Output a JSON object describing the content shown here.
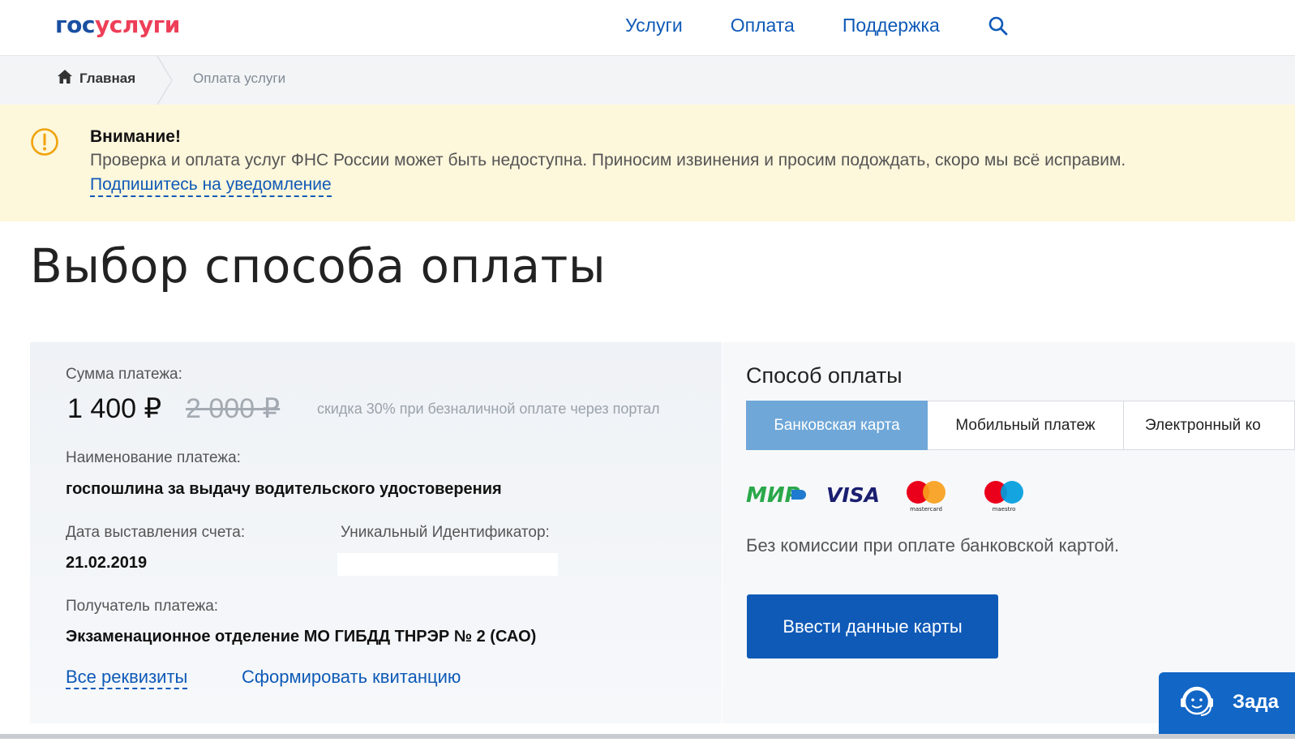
{
  "header": {
    "logo_part1": "гос",
    "logo_part2": "услуги",
    "nav": [
      "Услуги",
      "Оплата",
      "Поддержка"
    ]
  },
  "breadcrumb": {
    "home": "Главная",
    "current": "Оплата услуги"
  },
  "alert": {
    "title": "Внимание!",
    "text": "Проверка и оплата услуг ФНС России может быть недоступна. Приносим извинения и просим подождать, скоро мы всё исправим.",
    "link": "Подпишитесь на уведомление"
  },
  "page_title": "Выбор способа оплаты",
  "payment": {
    "amount_label": "Сумма платежа:",
    "amount": "1 400 ₽",
    "amount_old": "2 000 ₽",
    "discount_note": "скидка 30% при безналичной оплате через портал",
    "name_label": "Наименование платежа:",
    "name": "госпошлина за выдачу водительского удостоверения",
    "date_label": "Дата выставления счета:",
    "date": "21.02.2019",
    "uid_label": "Уникальный Идентификатор:",
    "recipient_label": "Получатель платежа:",
    "recipient": "Экзаменационное отделение МО ГИБДД ТНРЭР № 2 (САО)",
    "link_details": "Все реквизиты",
    "link_receipt": "Сформировать квитанцию"
  },
  "method": {
    "title": "Способ оплаты",
    "tabs": [
      "Банковская карта",
      "Мобильный платеж",
      "Электронный ко"
    ],
    "active_tab": "Банковская карта",
    "logos": {
      "mir": "МИР",
      "visa": "VISA",
      "mastercard": "mastercard",
      "maestro": "maestro"
    },
    "no_fee": "Без комиссии при оплате банковской картой.",
    "button": "Ввести данные карты"
  },
  "support": {
    "label": "Зада"
  },
  "colors": {
    "primary": "#0f5ab7",
    "logo_red": "#ee3f58",
    "logo_blue": "#1a4fa1",
    "alert_bg": "#fdf7dc",
    "alert_icon": "#f0a30a",
    "tab_active": "#6fa7d8"
  }
}
